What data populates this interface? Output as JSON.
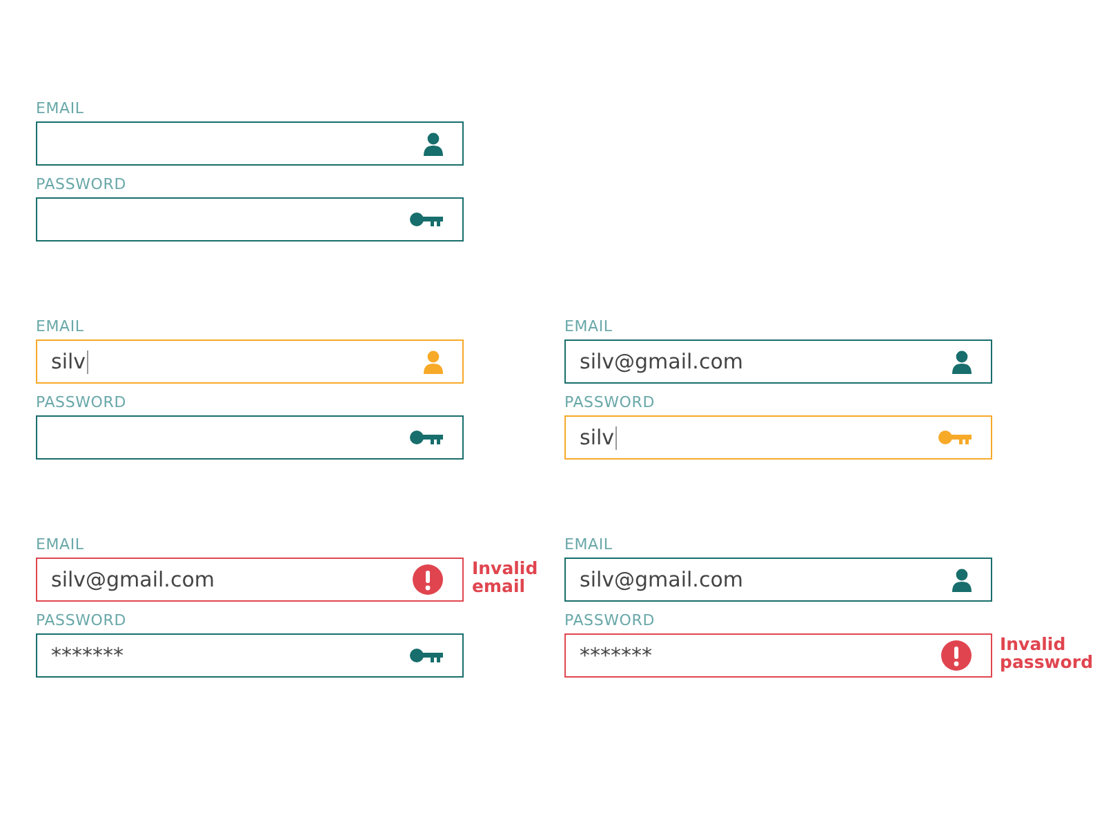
{
  "rows": [
    {
      "forms": [
        {
          "fields": [
            {
              "label": "EMAIL",
              "kind": "email",
              "focused": false,
              "invalid": false
            },
            {
              "label": "PASSWORD",
              "kind": "password",
              "focused": false,
              "invalid": false
            }
          ]
        }
      ]
    },
    {
      "forms": [
        {
          "fields": [
            {
              "label": "EMAIL",
              "kind": "email",
              "focused": true,
              "invalid": false,
              "value": "silv"
            },
            {
              "label": "PASSWORD",
              "kind": "password",
              "focused": false,
              "invalid": false
            }
          ]
        },
        {
          "fields": [
            {
              "label": "EMAIL",
              "kind": "email",
              "focused": false,
              "invalid": false,
              "value": "silv@gmail.com"
            },
            {
              "label": "PASSWORD",
              "kind": "password",
              "focused": true,
              "invalid": false,
              "value": "silv"
            }
          ]
        }
      ]
    },
    {
      "forms": [
        {
          "fields": [
            {
              "label": "EMAIL",
              "focused": false,
              "invalid": true,
              "value": "silv@gmail.com",
              "error": "Invalid email"
            },
            {
              "label": "PASSWORD",
              "kind": "password",
              "focused": false,
              "invalid": false,
              "value": "*******"
            }
          ]
        },
        {
          "fields": [
            {
              "label": "EMAIL",
              "kind": "email",
              "focused": false,
              "invalid": false,
              "value": "silv@gmail.com"
            },
            {
              "label": "PASSWORD",
              "focused": false,
              "invalid": true,
              "value": "*******",
              "error": "Invalid password"
            }
          ]
        }
      ]
    }
  ]
}
